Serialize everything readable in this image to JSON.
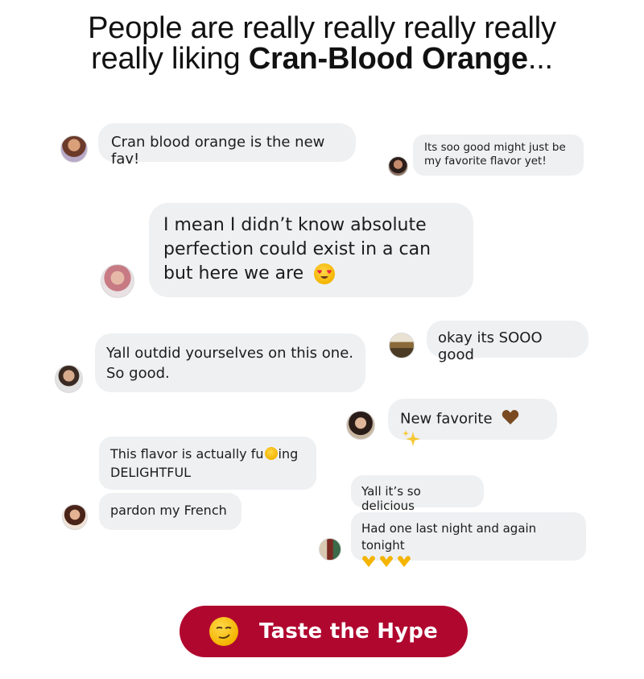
{
  "headline": {
    "line1": "People are really really really really",
    "line2_prefix": "really liking ",
    "line2_bold": "Cran-Blood Orange",
    "line2_suffix": "..."
  },
  "messages": [
    {
      "text": "Cran blood orange is the new fav!"
    },
    {
      "text": "Its soo good might just be my favorite flavor yet!"
    },
    {
      "text": "I mean I didn’t know absolute perfection could exist in a can but here we are"
    },
    {
      "text": "okay its SOOO good"
    },
    {
      "text": "Yall outdid yourselves on this one. So good."
    },
    {
      "text": "New favorite"
    },
    {
      "text_before": "This flavor is actually fu",
      "text_after": "ing",
      "line2": "DELIGHTFUL"
    },
    {
      "text": "pardon my French"
    },
    {
      "text": "Yall it’s so delicious"
    },
    {
      "text": "Had one last night and again tonight"
    }
  ],
  "cta": {
    "label": "Taste the Hype",
    "color": "#b0072f"
  },
  "colors": {
    "bubble": "#eef0f2",
    "text": "#1c1c1c"
  }
}
